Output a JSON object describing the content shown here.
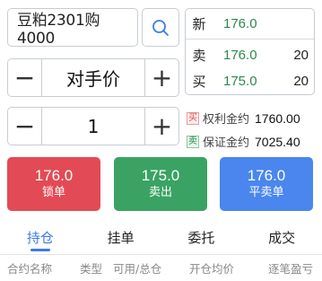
{
  "order": {
    "contract": "豆粕2301购4000",
    "price_type": "对手价",
    "quantity": "1",
    "minus_symbol": "−",
    "plus_symbol": "+"
  },
  "quote": {
    "last": {
      "label": "新",
      "price": "176.0",
      "volume": ""
    },
    "ask": {
      "label": "卖",
      "price": "176.0",
      "volume": "20"
    },
    "bid": {
      "label": "买",
      "price": "175.0",
      "volume": "20"
    }
  },
  "margin": {
    "premium": {
      "tag": "买",
      "label": "权利金约",
      "value": "1760.00"
    },
    "deposit": {
      "tag": "卖",
      "label": "保证金约",
      "value": "7025.40"
    }
  },
  "actions": [
    {
      "price": "176.0",
      "label": "锁单",
      "color": "#e24b55"
    },
    {
      "price": "175.0",
      "label": "卖出",
      "color": "#3aa363"
    },
    {
      "price": "176.0",
      "label": "平卖单",
      "color": "#4a86ee"
    }
  ],
  "tabs": [
    {
      "label": "持仓",
      "active": true
    },
    {
      "label": "挂单",
      "active": false
    },
    {
      "label": "委托",
      "active": false
    },
    {
      "label": "成交",
      "active": false
    }
  ],
  "columns": [
    "合约名称",
    "类型",
    "可用/总仓",
    "开仓均价",
    "逐笔盈亏"
  ],
  "icons": {
    "search": "search-icon"
  },
  "colors": {
    "accent": "#3b7be6",
    "up": "#e24b55",
    "down": "#3aa363"
  }
}
